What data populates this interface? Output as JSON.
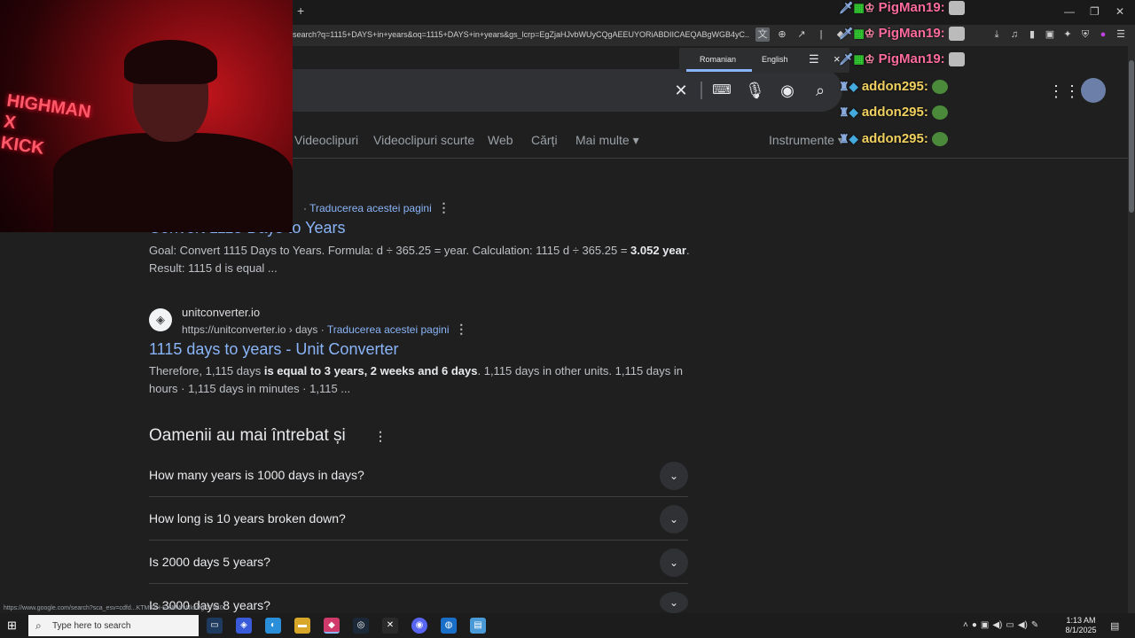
{
  "browser": {
    "new_tab": "+",
    "win_minimize": "—",
    "win_restore": "❐",
    "win_close": "✕",
    "url": "search?q=1115+DAYS+in+years&oq=1115+DAYS+in+years&gs_lcrp=EgZjaHJvbWUyCQgAEEUYORiABDIICAEQABgWGB4yC..."
  },
  "translate_popup": {
    "source_lang": "Romanian",
    "target_lang": "English",
    "menu": "☰",
    "close": "×"
  },
  "nav": {
    "items": [
      "Videoclipuri",
      "Videoclipuri scurte",
      "Web",
      "Cărți",
      "Mai multe ▾"
    ],
    "tools": "Instrumente ▾"
  },
  "results": [
    {
      "translate": "Traducerea acestei pagini",
      "title": "Convert 1115 Days to Years",
      "snippet_a": "Goal: Convert 1115 Days to Years. Formula: d ÷ 365.25 = year. Calculation: 1115 d ÷ 365.25 = ",
      "snippet_b": "3.052 year",
      "snippet_c": ". Result: 1115 d is equal ..."
    },
    {
      "site": "unitconverter.io",
      "url": "https://unitconverter.io › days",
      "translate": "Traducerea acestei pagini",
      "title": "1115 days to years - Unit Converter",
      "snippet_a": "Therefore, 1,115 days ",
      "snippet_b": "is equal to 3 years, 2 weeks and 6 days",
      "snippet_c": ". 1,115 days in other units. 1,115 days in hours · 1,115 days in minutes · 1,115 ..."
    }
  ],
  "paa": {
    "title": "Oamenii au mai întrebat și",
    "questions": [
      "How many years is 1000 days in days?",
      "How long is 10 years broken down?",
      "Is 2000 days 5 years?",
      "Is 3000 days 8 years?"
    ]
  },
  "webcam": {
    "sign_text": "HIGHMAN\nX\nKICK"
  },
  "chat": [
    {
      "user": "PigMan19:",
      "color": "#ff6b9e"
    },
    {
      "user": "PigMan19:",
      "color": "#ff6b9e"
    },
    {
      "user": "PigMan19:",
      "color": "#ff6b9e"
    },
    {
      "user": "addon295:",
      "color": "#f0d060"
    },
    {
      "user": "addon295:",
      "color": "#f0d060"
    },
    {
      "user": "addon295:",
      "color": "#f0d060"
    }
  ],
  "status_url": "https://www.google.com/search?sca_esv=cdfd...KTMfGH-Et6MWkNkxVg:17540...",
  "taskbar": {
    "search_placeholder": "Type here to search",
    "time": "1:13 AM",
    "date": "8/1/2025"
  }
}
